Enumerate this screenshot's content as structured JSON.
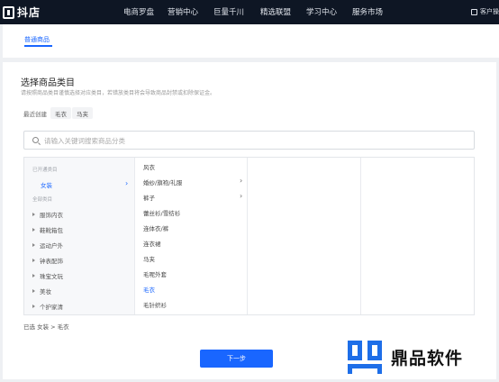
{
  "header": {
    "app_name": "抖店",
    "nav": [
      "电商罗盘",
      "营销中心",
      "巨量千川",
      "精选联盟",
      "学习中心",
      "服务市场"
    ],
    "help_label": "客户操"
  },
  "tabs": {
    "active_label": "普通商品"
  },
  "category_section": {
    "title": "选择商品类目",
    "description": "请按照商品类目谨慎选择对应类目，若错放类目将会导致商品封禁或扣除保证金。",
    "recent_label": "最近创建",
    "recent_chips": [
      "毛衣",
      "马夹"
    ],
    "search_placeholder": "请输入关键词搜索商品分类"
  },
  "picker": {
    "opened_label": "已开通类目",
    "opened_selected": "女装",
    "all_label": "全部类目",
    "all_items": [
      "服饰内衣",
      "鞋靴箱包",
      "运动户外",
      "钟表配饰",
      "珠宝文玩",
      "美妆",
      "个护家清"
    ],
    "level2": [
      {
        "label": "风衣",
        "has_children": false,
        "active": false
      },
      {
        "label": "婚纱/旗袍/礼服",
        "has_children": true,
        "active": false
      },
      {
        "label": "裤子",
        "has_children": true,
        "active": false
      },
      {
        "label": "蕾丝衫/雪纺衫",
        "has_children": false,
        "active": false
      },
      {
        "label": "连体衣/裤",
        "has_children": false,
        "active": false
      },
      {
        "label": "连衣裙",
        "has_children": false,
        "active": false
      },
      {
        "label": "马夹",
        "has_children": false,
        "active": false
      },
      {
        "label": "毛呢外套",
        "has_children": false,
        "active": false
      },
      {
        "label": "毛衣",
        "has_children": false,
        "active": true
      },
      {
        "label": "毛针织衫",
        "has_children": false,
        "active": false
      }
    ]
  },
  "selected_path": "已选 女装 > 毛衣",
  "next_button": "下一步",
  "watermark": {
    "text": "鼎品软件",
    "color": "#1e6ee8"
  }
}
